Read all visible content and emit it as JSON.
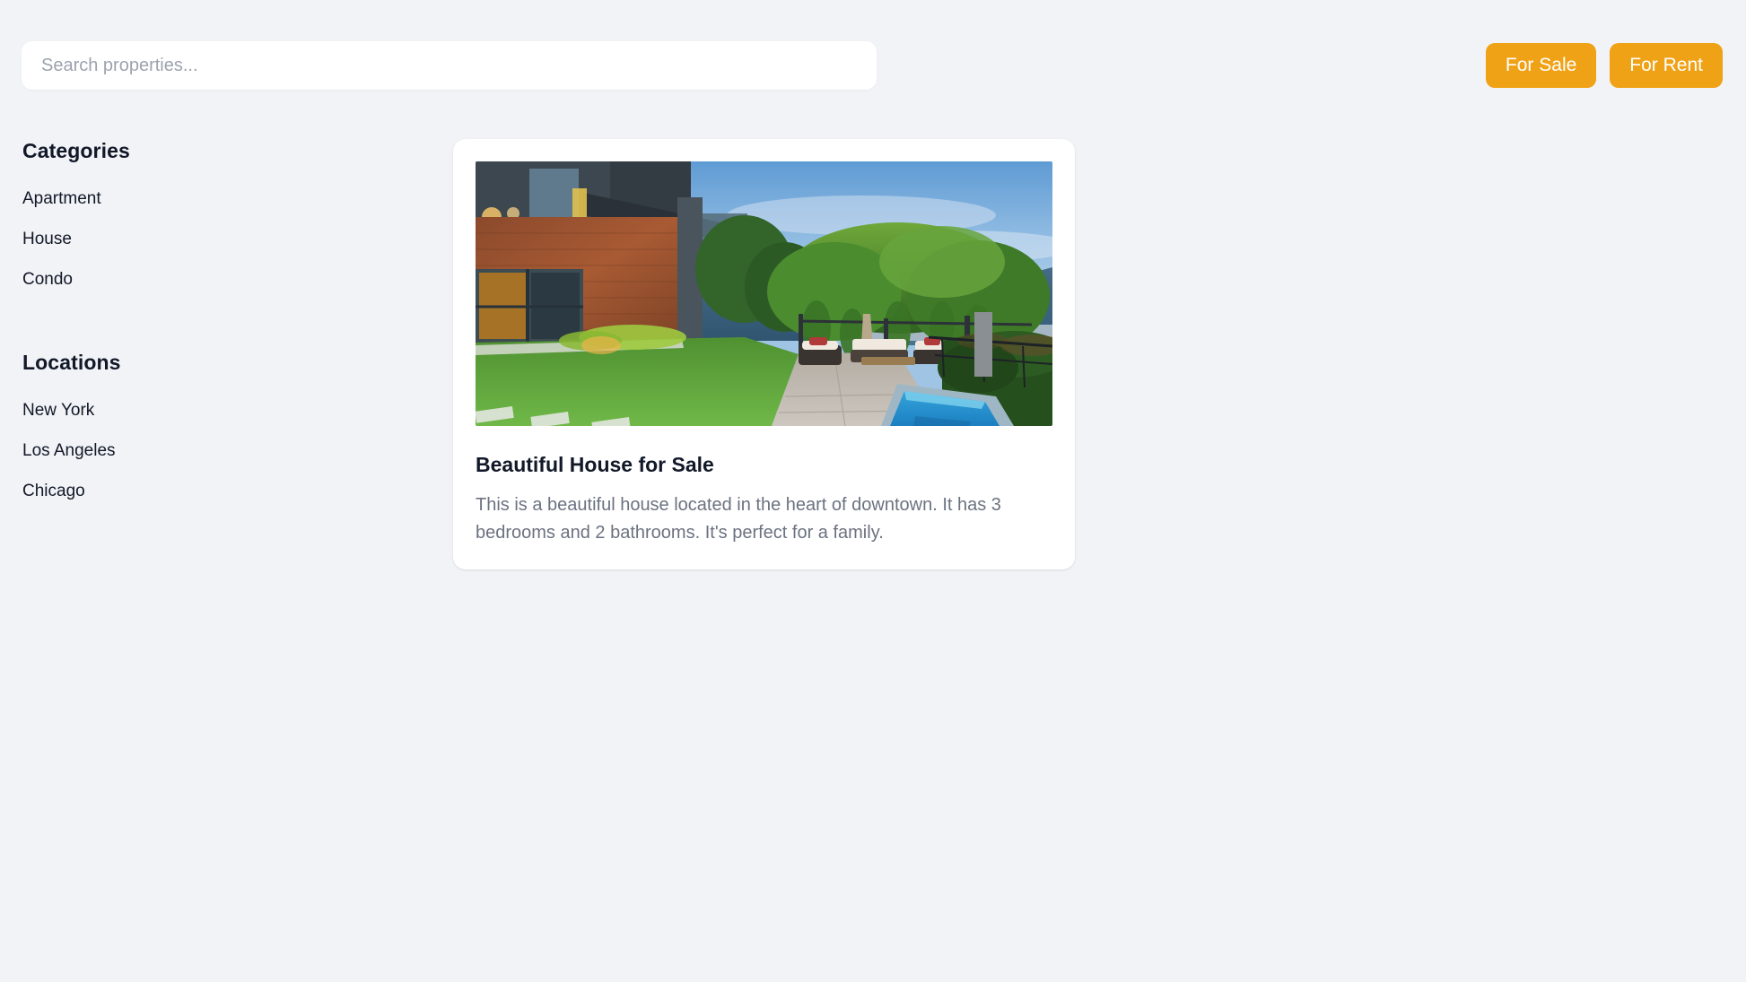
{
  "search": {
    "placeholder": "Search properties...",
    "value": ""
  },
  "filters": {
    "for_sale_label": "For Sale",
    "for_rent_label": "For Rent",
    "accent_color": "#f0a217"
  },
  "sidebar": {
    "categories": {
      "heading": "Categories",
      "items": [
        {
          "label": "Apartment"
        },
        {
          "label": "House"
        },
        {
          "label": "Condo"
        }
      ]
    },
    "locations": {
      "heading": "Locations",
      "items": [
        {
          "label": "New York"
        },
        {
          "label": "Los Angeles"
        },
        {
          "label": "Chicago"
        }
      ]
    }
  },
  "listings": [
    {
      "title": "Beautiful House for Sale",
      "description": "This is a beautiful house located in the heart of downtown. It has 3 bedrooms and 2 bathrooms. It's perfect for a family.",
      "image_alt": "modern-house-with-pool-and-garden"
    }
  ],
  "theme": {
    "page_background": "#f2f3f7",
    "card_background": "#ffffff",
    "heading_color": "#111827",
    "muted_text_color": "#6b7280",
    "placeholder_color": "#9ca3af"
  }
}
